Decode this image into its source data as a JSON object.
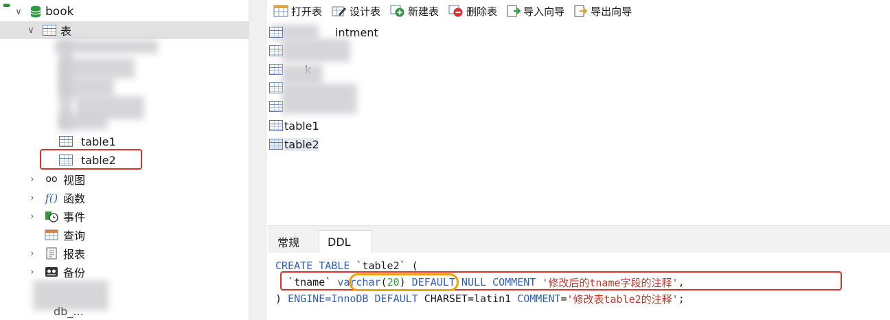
{
  "sidebar": {
    "db_name": "book",
    "tables_label": "表",
    "table1": "table1",
    "table2": "table2",
    "views": "视图",
    "functions": "函数",
    "events": "事件",
    "queries": "查询",
    "reports": "报表",
    "backups": "备份",
    "bottom_partial": "db_..."
  },
  "toolbar": {
    "open": "打开表",
    "design": "设计表",
    "new": "新建表",
    "delete": "删除表",
    "import": "导入向导",
    "export": "导出向导"
  },
  "list": {
    "partial1": "intment",
    "partial2": "k",
    "table1": "table1",
    "table2": "table2"
  },
  "tabs": {
    "general": "常规",
    "ddl": "DDL"
  },
  "ddl": {
    "l1_kw": "CREATE TABLE",
    "l1_rest": " `table2` (",
    "l2_col": "  `tname` ",
    "l2_type": "varchar",
    "l2_paren_open": "(",
    "l2_len": "20",
    "l2_paren_close": ")",
    "l2_kw": " DEFAULT NULL COMMENT ",
    "l2_comment": "'修改后的tname字段的注释'",
    "l2_end": ",",
    "l3_start": ") ",
    "l3_engine_kw": "ENGINE",
    "l3_engine_val": "=InnoDB ",
    "l3_default_kw": "DEFAULT",
    "l3_charset": " CHARSET=latin1 ",
    "l3_comment_kw": "COMMENT",
    "l3_eq": "=",
    "l3_comment": "'修改表table2的注释'",
    "l3_end": ";"
  },
  "colors": {
    "highlight_red": "#d8322c",
    "highlight_orange": "#f1a10f",
    "keyword_blue": "#2f5fbd",
    "string_red": "#c0392b",
    "number_green": "#2e9a3e"
  }
}
